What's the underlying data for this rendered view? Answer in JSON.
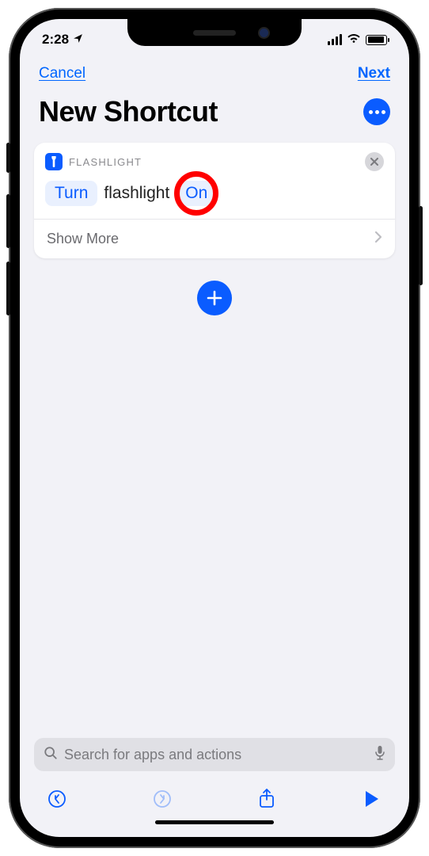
{
  "status": {
    "time": "2:28"
  },
  "nav": {
    "cancel": "Cancel",
    "next": "Next"
  },
  "title": "New Shortcut",
  "action": {
    "category": "FLASHLIGHT",
    "param_verb": "Turn",
    "param_noun": "flashlight",
    "param_state": "On",
    "show_more": "Show More"
  },
  "search": {
    "placeholder": "Search for apps and actions"
  },
  "annotation": {
    "circle_target": "state-pill-on"
  }
}
